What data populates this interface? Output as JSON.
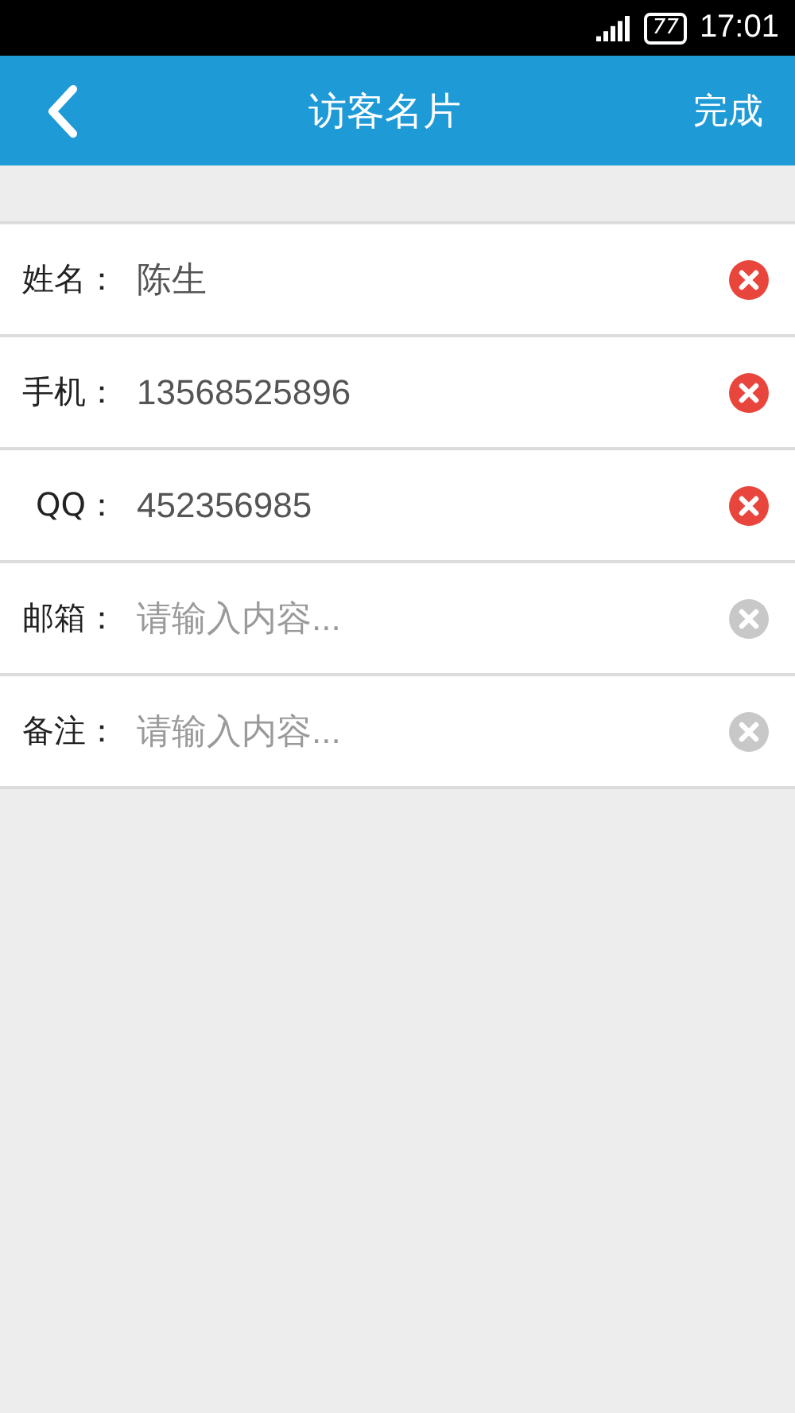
{
  "status_bar": {
    "battery": "77",
    "time": "17:01"
  },
  "header": {
    "title": "访客名片",
    "action": "完成"
  },
  "fields": [
    {
      "label": "姓名：",
      "value": "陈生"
    },
    {
      "label": "手机：",
      "value": "13568525896"
    },
    {
      "label": "QQ：",
      "value": "452356985"
    },
    {
      "label": "邮箱：",
      "placeholder": "请输入内容..."
    },
    {
      "label": "备注：",
      "placeholder": "请输入内容..."
    }
  ]
}
